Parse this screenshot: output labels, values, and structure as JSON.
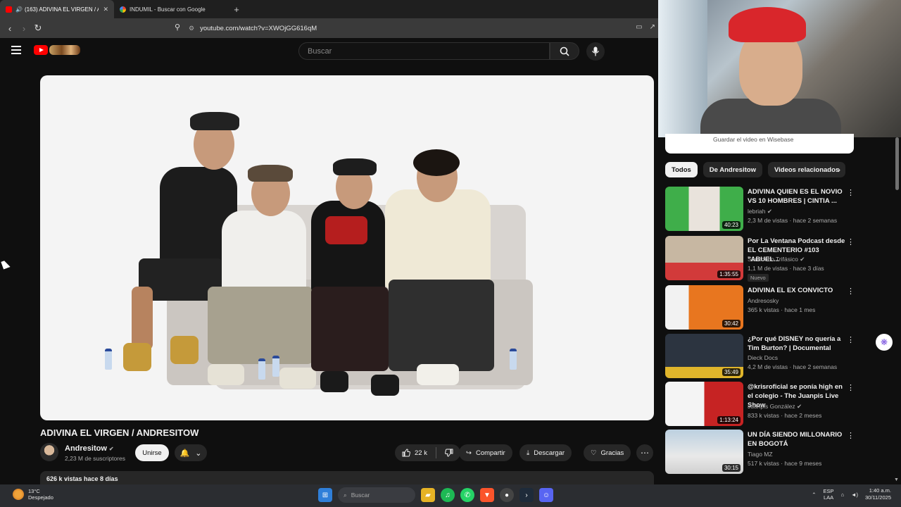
{
  "browser": {
    "tabs": [
      {
        "title": "(163) ADIVINA EL VIRGEN / A",
        "active": true,
        "audio": "🔊"
      },
      {
        "title": "INDUMIL - Buscar con Google",
        "active": false
      }
    ],
    "new_tab": "+",
    "url": "youtube.com/watch?v=XWOjGG616qM"
  },
  "youtube": {
    "search_placeholder": "Buscar",
    "video": {
      "title": "ADIVINA EL VIRGEN / ANDRESITOW",
      "channel": "Andresitow",
      "subscribers": "2,23 M de suscriptores",
      "join_label": "Unirse",
      "likes": "22 k",
      "share_label": "Compartir",
      "download_label": "Descargar",
      "thanks_label": "Gracias",
      "views_time": "626 k vistas  hace 8 días"
    },
    "wisebase_text": "Guardar el video en Wisebase",
    "chips": [
      "Todos",
      "De Andresitow",
      "Videos relacionados"
    ],
    "recommendations": [
      {
        "title": "ADIVINA QUIEN ES EL NOVIO VS 10 HOMBRES | CINTIA ...",
        "channel": "lebriah",
        "verified": true,
        "meta": "2,3 M de vistas · hace 2 semanas",
        "duration": "40:23",
        "badge": ""
      },
      {
        "title": "Por La Ventana Podcast desde EL CEMENTERIO #103 \"ABUEL...",
        "channel": "Sancocho Trifásico",
        "verified": true,
        "meta": "1,1 M de vistas · hace 3 días",
        "duration": "1:35:55",
        "badge": "Nuevo"
      },
      {
        "title": "ADIVINA EL EX CONVICTO",
        "channel": "Andresosky",
        "verified": false,
        "meta": "365 k vistas · hace 1 mes",
        "duration": "30:42",
        "badge": ""
      },
      {
        "title": "¿Por qué DISNEY no quería a Tim Burton? | Documental",
        "channel": "Dieck Docs",
        "verified": false,
        "meta": "4,2 M de vistas · hace 2 semanas",
        "duration": "35:49",
        "badge": ""
      },
      {
        "title": "@krisroficial se ponía high en el colegio - The Juanpis Live Show",
        "channel": "Juanpis González",
        "verified": true,
        "meta": "833 k vistas · hace 2 meses",
        "duration": "1:13:24",
        "badge": ""
      },
      {
        "title": "UN DÍA SIENDO MILLONARIO EN BOGOTÁ",
        "channel": "Tiago MZ",
        "verified": false,
        "meta": "517 k vistas · hace 9 meses",
        "duration": "30:15",
        "badge": ""
      }
    ]
  },
  "taskbar": {
    "weather_temp": "13°C",
    "weather_desc": "Despejado",
    "search_label": "Buscar",
    "lang_top": "ESP",
    "lang_bottom": "LAA",
    "time": "1:40 a.m.",
    "date": "30/11/2025"
  },
  "colors": {
    "background": "#0f0f0f",
    "youtube_red": "#ff0000",
    "chip_active": "#f1f1f1",
    "taskbar": "#2b2d31"
  }
}
